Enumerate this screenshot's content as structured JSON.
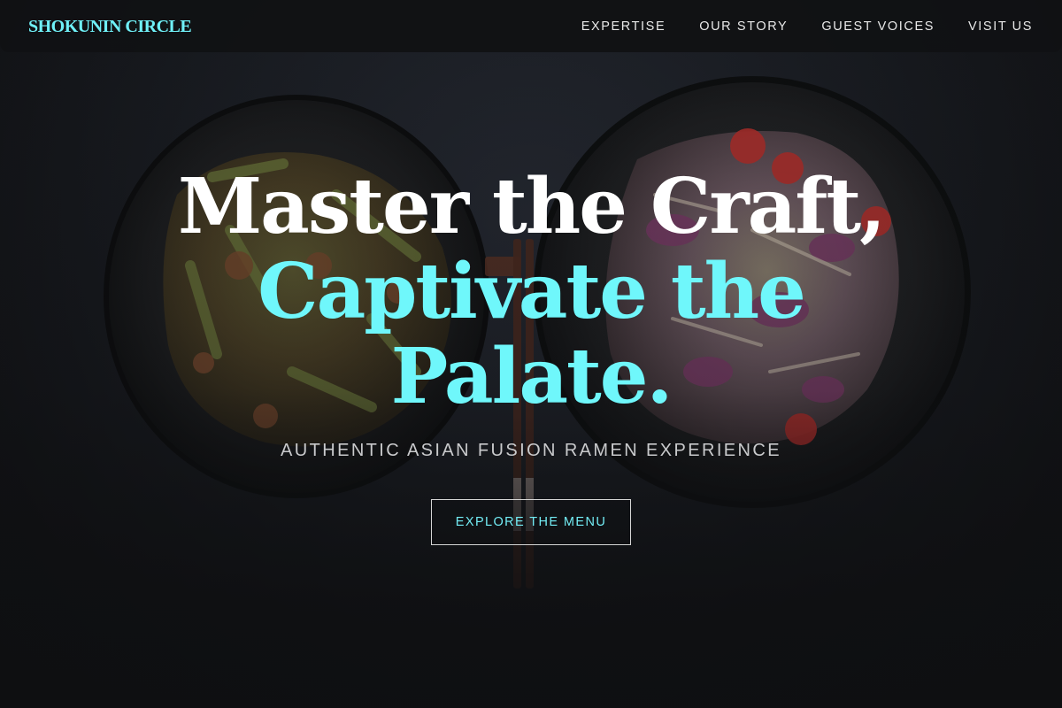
{
  "brand": {
    "name": "SHOKUNIN CIRCLE",
    "accent_color": "#6ff0f7"
  },
  "nav": {
    "items": [
      {
        "label": "EXPERTISE"
      },
      {
        "label": "OUR STORY"
      },
      {
        "label": "GUEST VOICES"
      },
      {
        "label": "VISIT US"
      }
    ]
  },
  "hero": {
    "headline_line1": "Master the Craft,",
    "headline_line2": "Captivate the",
    "headline_line3": "Palate.",
    "subtitle": "AUTHENTIC ASIAN FUSION RAMEN EXPERIENCE",
    "cta_label": "EXPLORE THE MENU",
    "background": "dark-table-two-bowls-photo"
  }
}
